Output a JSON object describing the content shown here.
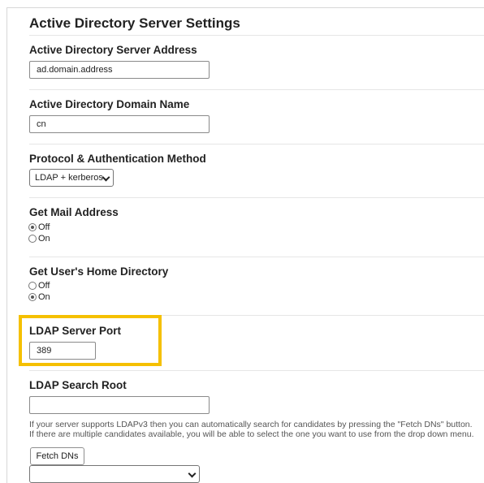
{
  "page": {
    "title": "Active Directory Server Settings"
  },
  "fields": {
    "server_address": {
      "label": "Active Directory Server Address",
      "value": "ad.domain.address"
    },
    "domain_name": {
      "label": "Active Directory Domain Name",
      "value": "cn"
    },
    "protocol": {
      "label": "Protocol & Authentication Method",
      "selected": "LDAP + kerberos"
    },
    "mail_address": {
      "label": "Get Mail Address",
      "options": [
        "Off",
        "On"
      ],
      "selected": "Off"
    },
    "home_directory": {
      "label": "Get User's Home Directory",
      "options": [
        "Off",
        "On"
      ],
      "selected": "On"
    },
    "ldap_port": {
      "label": "LDAP Server Port",
      "value": "389"
    },
    "search_root": {
      "label": "LDAP Search Root",
      "value": ""
    }
  },
  "search_root_info": {
    "line1": "If your server supports LDAPv3 then you can automatically search for candidates by pressing the \"Fetch DNs\" button.",
    "line2": "If there are multiple candidates available, you will be able to select the one you want to use from the drop down menu."
  },
  "buttons": {
    "fetch_dns": "Fetch DNs"
  },
  "dn_select": {
    "selected": ""
  },
  "colors": {
    "highlight": "#f5c000",
    "border": "#8a8a8a",
    "separator": "#e6e6e6"
  }
}
